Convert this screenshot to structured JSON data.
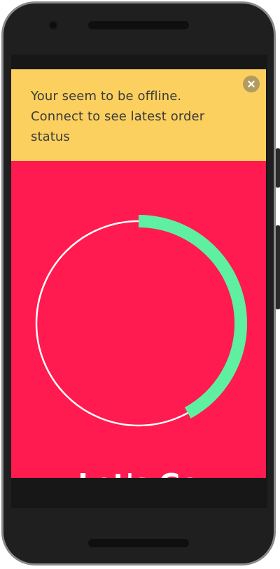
{
  "banner": {
    "message": "Your seem to be offline. Connect to see latest order status",
    "close_icon": "close-icon"
  },
  "order_status": {
    "heading": "Let's Go",
    "progress_fraction": 0.42
  },
  "colors": {
    "app_background": "#ff1a50",
    "banner_background": "#fcd05e",
    "progress": "#5ef0a0",
    "track": "#ffffff",
    "device_frame": "#1f1f1f"
  }
}
